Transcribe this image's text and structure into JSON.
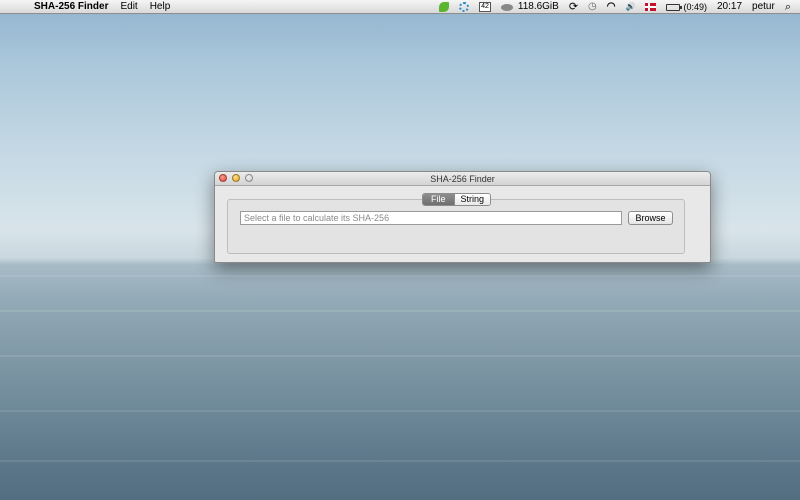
{
  "menubar": {
    "apple": "",
    "app_name": "SHA-256 Finder",
    "menus": [
      "Edit",
      "Help"
    ],
    "status": {
      "calendar_day": "42",
      "disk_free": "118.6GiB",
      "sync_glyph": "⟳",
      "clock_glyph": "◷",
      "wifi_glyph": "◠",
      "volume_glyph": "🔊",
      "battery_time": "(0:49)",
      "time": "20:17",
      "user": "petur",
      "search_glyph": "⌕"
    }
  },
  "window": {
    "title": "SHA-256 Finder",
    "tabs": [
      "File",
      "String"
    ],
    "active_tab": "File",
    "file_input": {
      "placeholder": "Select a file to calculate its SHA-256",
      "value": ""
    },
    "browse_label": "Browse"
  },
  "colors": {
    "close": "#e0443a",
    "minimize": "#e0a21c",
    "zoom": "#c7c7c7",
    "active_tab": "#7a7a7a"
  },
  "icons": {
    "apple": "apple-icon",
    "evernote": "leaf-icon",
    "settings": "gear-icon",
    "calendar": "calendar-icon",
    "disk": "disk-icon",
    "sync": "sync-icon",
    "time_machine": "clock-icon",
    "wifi": "wifi-icon",
    "volume": "volume-icon",
    "flag": "danish-flag-icon",
    "battery": "battery-icon",
    "spotlight": "search-icon"
  }
}
